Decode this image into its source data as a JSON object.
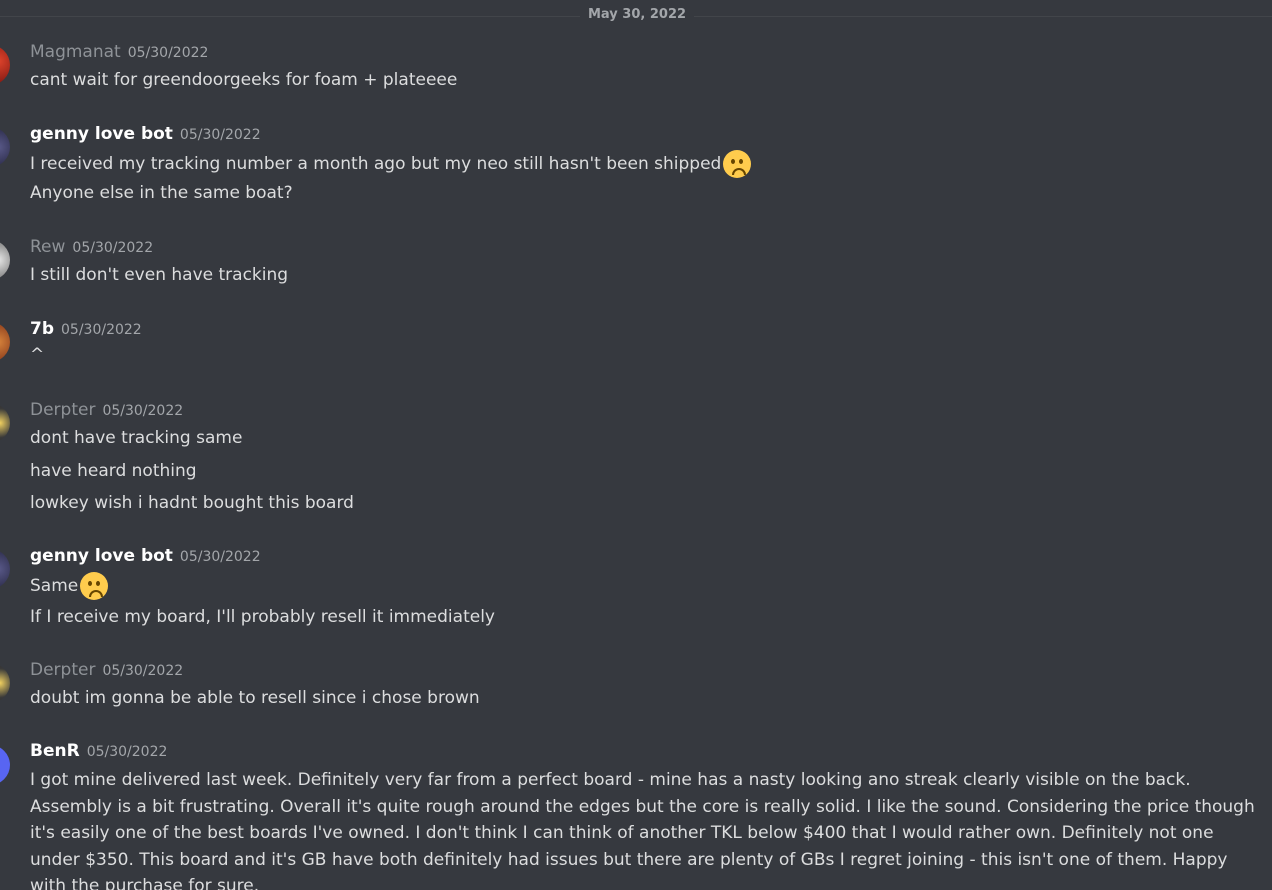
{
  "date_divider": "May 30, 2022",
  "messages": [
    {
      "username": "Magmanat",
      "timestamp": "05/30/2022",
      "lines": [
        "cant wait for greendoorgeeks for foam + plateeee"
      ]
    },
    {
      "username": "genny love bot",
      "timestamp": "05/30/2022",
      "lines": [
        "I received my tracking number a month ago but my neo still hasn't been shipped",
        "Anyone else in the same boat?"
      ],
      "emoji": "frowning-face-emoji"
    },
    {
      "username": "Rew",
      "timestamp": "05/30/2022",
      "lines": [
        "I still don't even have tracking"
      ]
    },
    {
      "username": "7b",
      "timestamp": "05/30/2022",
      "lines": [
        "^"
      ]
    },
    {
      "username": "Derpter",
      "timestamp": "05/30/2022",
      "lines": [
        "dont have tracking same",
        "have heard nothing",
        "lowkey wish i hadnt bought this board"
      ]
    },
    {
      "username": "genny love bot",
      "timestamp": "05/30/2022",
      "lines": [
        "Same",
        "If I receive my board, I'll probably resell it immediately"
      ],
      "emoji": "frowning-face-emoji"
    },
    {
      "username": "Derpter",
      "timestamp": "05/30/2022",
      "lines": [
        "doubt im gonna be able to resell since i chose brown"
      ]
    },
    {
      "username": "BenR",
      "timestamp": "05/30/2022",
      "lines": [
        "I got mine delivered last week. Definitely very far from a perfect board - mine has a nasty looking ano streak clearly visible on the back. Assembly is a bit frustrating. Overall it's quite rough around the edges but the core is really solid. I like the sound. Considering the price though it's easily one of the best boards I've owned. I don't think I can think of another TKL below $400 that I would rather own. Definitely not one under $350. This board and it's GB have both definitely had issues but there are plenty of GBs I regret joining - this isn't one of them. Happy with the purchase for sure."
      ]
    }
  ],
  "colors": {
    "background": "#36393f",
    "text": "#dcddde",
    "username_white": "#ffffff",
    "username_gray": "#8e9297",
    "timestamp": "#a3a6aa",
    "avatar_benr": "#5865f2"
  }
}
